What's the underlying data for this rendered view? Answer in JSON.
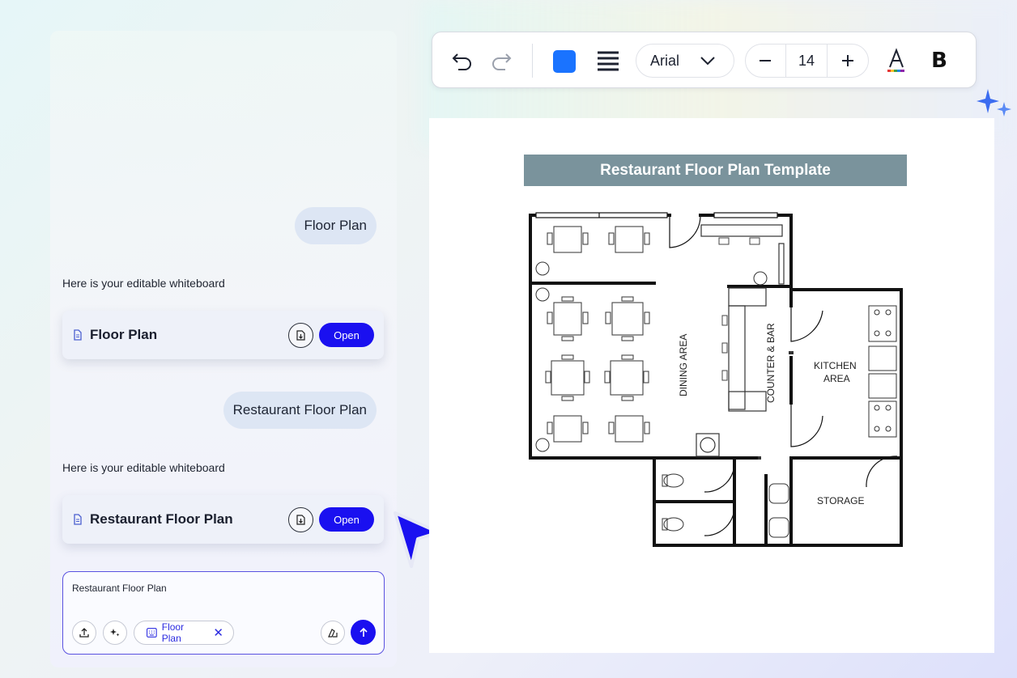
{
  "chat": {
    "messages": [
      {
        "role": "user",
        "text": "Floor Plan"
      },
      {
        "role": "assistant",
        "text": "Here is your editable whiteboard",
        "file_title": "Floor Plan",
        "open_label": "Open"
      },
      {
        "role": "user",
        "text": "Restaurant Floor Plan"
      },
      {
        "role": "assistant",
        "text": "Here is your editable whiteboard",
        "file_title": "Restaurant Floor Plan",
        "open_label": "Open"
      }
    ],
    "input": {
      "value": "Restaurant Floor Plan",
      "tag_label": "Floor Plan"
    }
  },
  "toolbar": {
    "fill_color": "#1a73ff",
    "font_family": "Arial",
    "font_size": "14",
    "bold_label": "B"
  },
  "canvas": {
    "title": "Restaurant Floor Plan Template",
    "rooms": {
      "dining": "DINING AREA",
      "counter": "COUNTER & BAR",
      "kitchen_line1": "KITCHEN",
      "kitchen_line2": "AREA",
      "storage": "STORAGE"
    }
  },
  "colors": {
    "accent": "#1a10f0",
    "title_bar": "#7a939c"
  }
}
